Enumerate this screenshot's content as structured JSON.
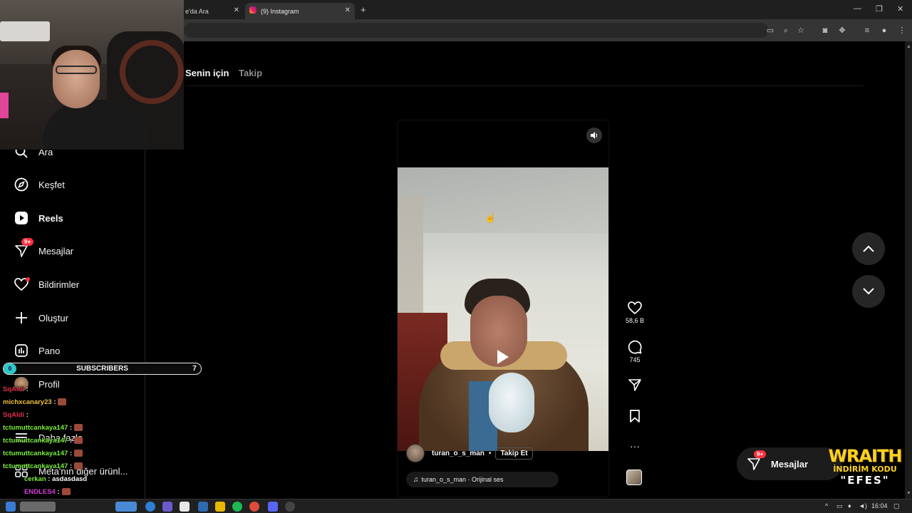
{
  "browser": {
    "tabs": [
      {
        "label": "e'da Ara",
        "active": false
      },
      {
        "label": "(9) Instagram",
        "active": true
      }
    ],
    "new_tab": "+",
    "window_controls": {
      "minimize": "—",
      "restore": "❐",
      "close": "✕"
    }
  },
  "sidebar": {
    "items": [
      {
        "label": "Ara",
        "icon": "search-icon"
      },
      {
        "label": "Keşfet",
        "icon": "compass-icon"
      },
      {
        "label": "Reels",
        "icon": "reels-icon",
        "active": true
      },
      {
        "label": "Mesajlar",
        "icon": "messenger-icon",
        "badge": "9+"
      },
      {
        "label": "Bildirimler",
        "icon": "heart-icon",
        "dot": true
      },
      {
        "label": "Oluştur",
        "icon": "plus-icon"
      },
      {
        "label": "Pano",
        "icon": "dashboard-icon"
      },
      {
        "label": "Profil",
        "icon": "avatar-icon"
      },
      {
        "label": "Daha fazla",
        "icon": "menu-icon"
      },
      {
        "label": "Meta'nın diğer ürünl...",
        "icon": "grid-icon"
      }
    ]
  },
  "feed_tabs": {
    "for_you": "Senin için",
    "following": "Takip"
  },
  "reel": {
    "username": "turan_o_s_man",
    "separator": "•",
    "follow_label": "Takip Et",
    "audio": "turan_o_s_man · Orijinal ses",
    "likes": "58,6 B",
    "comments": "745"
  },
  "messages_pill": {
    "label": "Mesajlar",
    "badge": "9+"
  },
  "overlay": {
    "subscribers": {
      "label": "SUBSCRIBERS",
      "start": "0",
      "count": "7"
    },
    "chat": [
      {
        "user": "SqAldi",
        "msg": ":",
        "color": "#e0304a"
      },
      {
        "user": "michxcanary23",
        "msg": ":",
        "color": "#f0c040"
      },
      {
        "user": "SqAldi",
        "msg": ":",
        "color": "#e0304a"
      },
      {
        "user": "tctumuttcankaya147",
        "msg": ":",
        "color": "#7cf03a"
      },
      {
        "user": "tctumuttcankaya147",
        "msg": ":",
        "color": "#7cf03a"
      },
      {
        "user": "tctumuttcankaya147",
        "msg": ":",
        "color": "#7cf03a"
      },
      {
        "user": "tctumuttcankaya147",
        "msg": ":",
        "color": "#7cf03a"
      },
      {
        "user": "cerkan",
        "msg": ": asdasdasd",
        "color": "#7cf03a"
      },
      {
        "user": "ENDLES4",
        "msg": ":",
        "color": "#d83adb"
      }
    ],
    "promo": {
      "line1": "WRAITH",
      "line2": "İNDİRİM KODU",
      "line3": "\"EFES\""
    }
  },
  "taskbar": {
    "time": "16:04"
  },
  "colors": {
    "accent_red": "#ff3040",
    "background": "#000000",
    "muted": "#8e8e8e"
  }
}
